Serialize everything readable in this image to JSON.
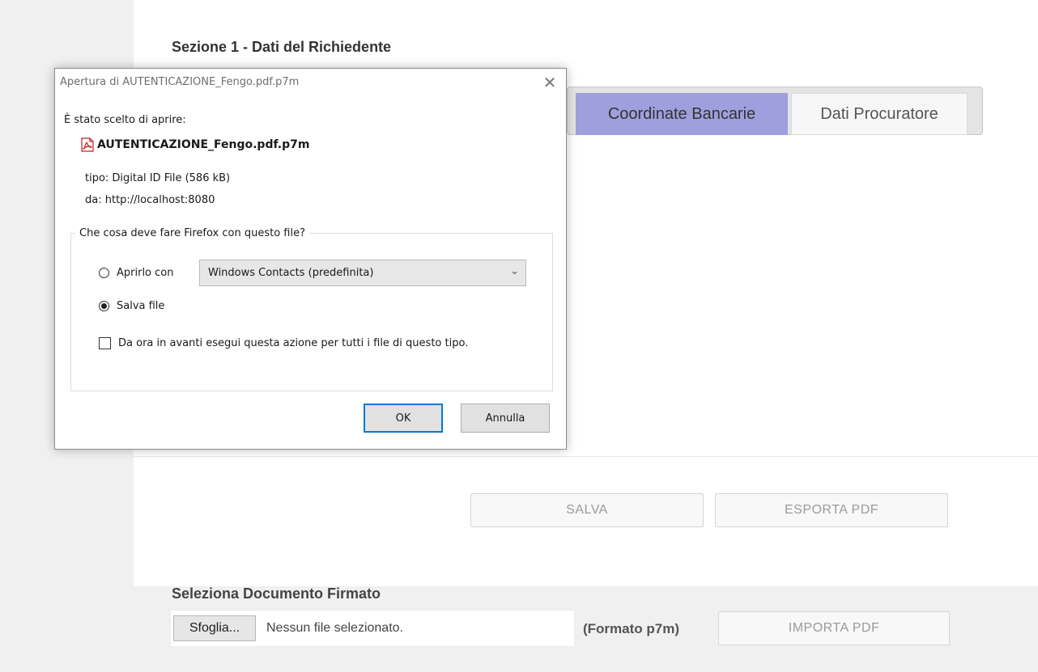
{
  "page": {
    "section_title": "Sezione 1 - Dati del Richiedente",
    "tabs": [
      {
        "label": "Coordinate Bancarie",
        "active": true
      },
      {
        "label": "Dati Procuratore",
        "active": false
      }
    ],
    "buttons": {
      "salva": "SALVA",
      "esporta": "ESPORTA PDF",
      "importa": "IMPORTA PDF"
    },
    "select_document_label": "Seleziona Documento Firmato",
    "file_input": {
      "browse_label": "Sfoglia...",
      "status": "Nessun file selezionato."
    },
    "format_hint": "(Formato p7m)",
    "colors": {
      "active_tab": "#9f9fdd",
      "ok_focus": "#0078d7"
    }
  },
  "dialog": {
    "title": "Apertura di AUTENTICAZIONE_Fengo.pdf.p7m",
    "intro": "È stato scelto di aprire:",
    "file_name": "AUTENTICAZIONE_Fengo.pdf.p7m",
    "file_icon": "pdf-file-icon",
    "type_line": "tipo: Digital ID File (586 kB)",
    "from_line": "da: http://localhost:8080",
    "question": "Che cosa deve fare Firefox con questo file?",
    "open_with_label": "Aprirlo con",
    "open_with_app": "Windows Contacts (predefinita)",
    "save_label": "Salva file",
    "selected_action": "save",
    "remember_label": "Da ora in avanti esegui questa azione per tutti i file di questo tipo.",
    "remember_checked": false,
    "ok_label": "OK",
    "cancel_label": "Annulla"
  }
}
